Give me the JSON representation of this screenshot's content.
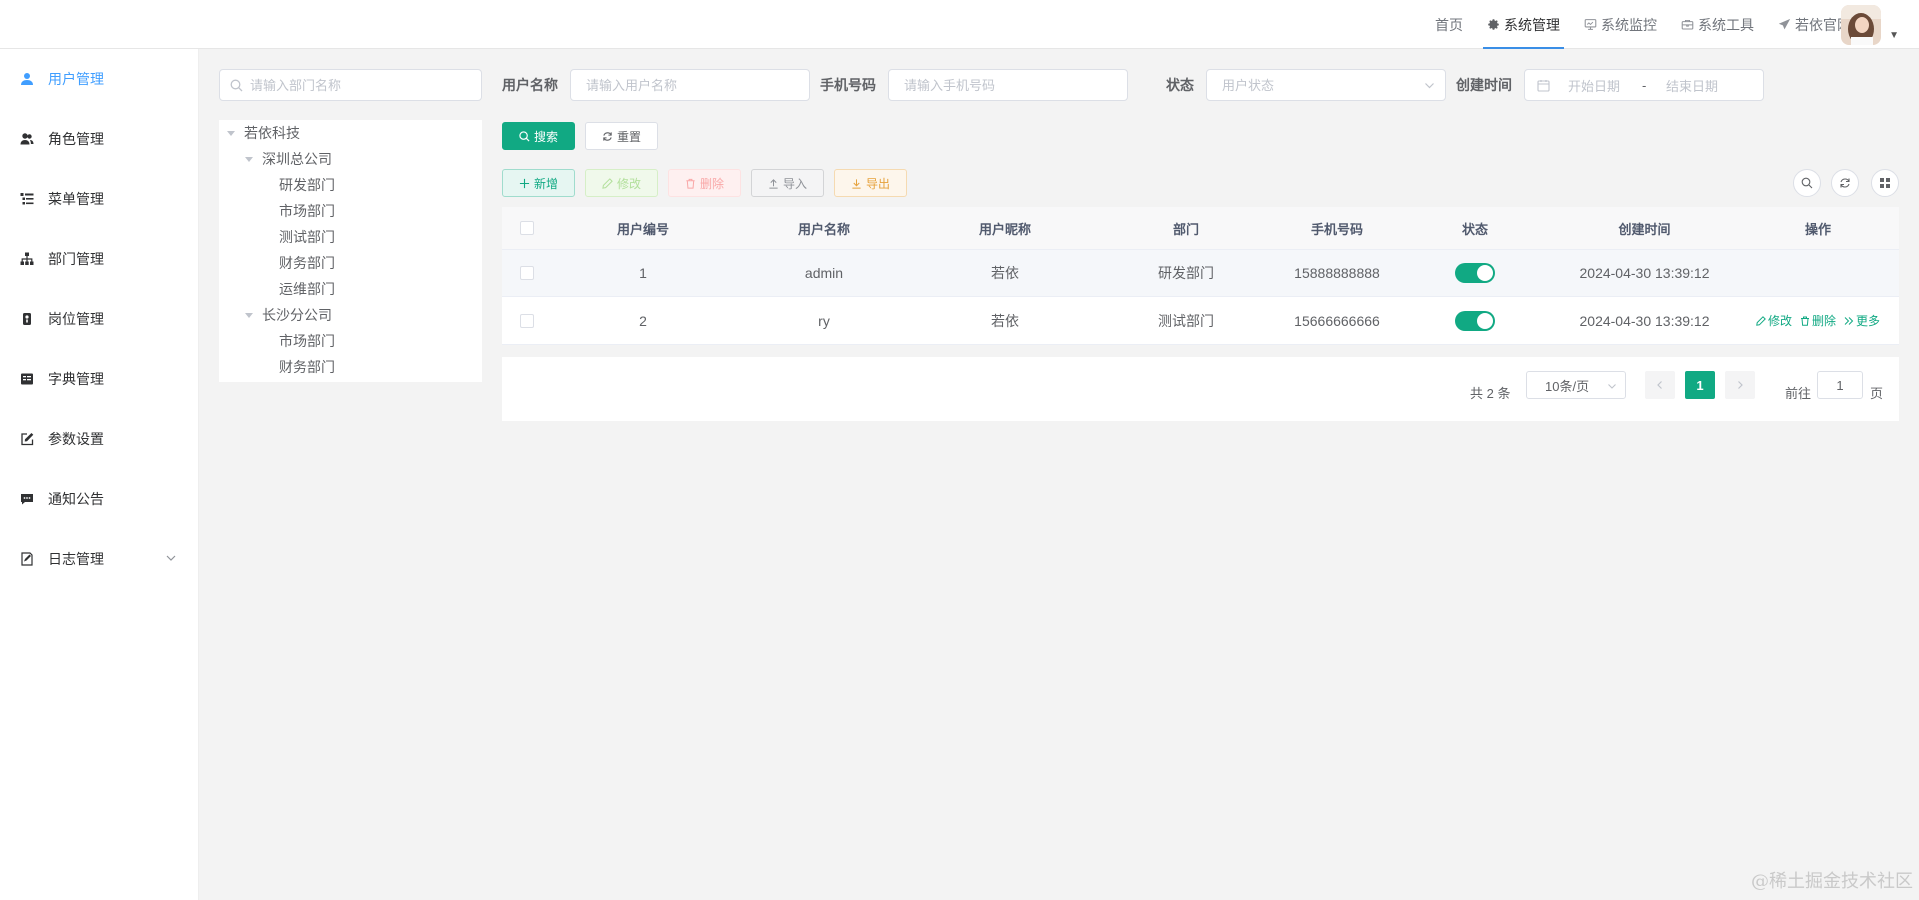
{
  "topnav": [
    {
      "label": "首页",
      "icon": "none"
    },
    {
      "label": "系统管理",
      "icon": "gear-icon",
      "active": true
    },
    {
      "label": "系统监控",
      "icon": "monitor-icon"
    },
    {
      "label": "系统工具",
      "icon": "toolbox-icon"
    },
    {
      "label": "若依官网",
      "icon": "send-icon"
    }
  ],
  "sidebar": {
    "items": [
      {
        "label": "用户管理",
        "icon": "user-icon",
        "active": true
      },
      {
        "label": "角色管理",
        "icon": "peoples-icon"
      },
      {
        "label": "菜单管理",
        "icon": "tree-table-icon"
      },
      {
        "label": "部门管理",
        "icon": "tree-icon"
      },
      {
        "label": "岗位管理",
        "icon": "post-icon"
      },
      {
        "label": "字典管理",
        "icon": "dict-icon"
      },
      {
        "label": "参数设置",
        "icon": "edit-icon"
      },
      {
        "label": "通知公告",
        "icon": "message-icon"
      },
      {
        "label": "日志管理",
        "icon": "log-icon",
        "expandable": true
      }
    ]
  },
  "dept": {
    "search_placeholder": "请输入部门名称",
    "tree": [
      {
        "label": "若依科技",
        "level": 0,
        "expanded": true
      },
      {
        "label": "深圳总公司",
        "level": 1,
        "expanded": true
      },
      {
        "label": "研发部门",
        "level": 2
      },
      {
        "label": "市场部门",
        "level": 2
      },
      {
        "label": "测试部门",
        "level": 2
      },
      {
        "label": "财务部门",
        "level": 2
      },
      {
        "label": "运维部门",
        "level": 2
      },
      {
        "label": "长沙分公司",
        "level": 1,
        "expanded": true
      },
      {
        "label": "市场部门",
        "level": 2
      },
      {
        "label": "财务部门",
        "level": 2
      }
    ]
  },
  "form": {
    "username_label": "用户名称",
    "username_placeholder": "请输入用户名称",
    "phone_label": "手机号码",
    "phone_placeholder": "请输入手机号码",
    "status_label": "状态",
    "status_placeholder": "用户状态",
    "date_label": "创建时间",
    "date_start": "开始日期",
    "date_sep": "-",
    "date_end": "结束日期",
    "search_btn": "搜索",
    "reset_btn": "重置"
  },
  "toolbar": {
    "add": "新增",
    "edit": "修改",
    "delete": "删除",
    "import": "导入",
    "export": "导出"
  },
  "table": {
    "headers": [
      "用户编号",
      "用户名称",
      "用户昵称",
      "部门",
      "手机号码",
      "状态",
      "创建时间",
      "操作"
    ],
    "rows": [
      {
        "id": "1",
        "username": "admin",
        "nickname": "若依",
        "dept": "研发部门",
        "phone": "15888888888",
        "status": true,
        "created": "2024-04-30 13:39:12",
        "ops": []
      },
      {
        "id": "2",
        "username": "ry",
        "nickname": "若依",
        "dept": "测试部门",
        "phone": "15666666666",
        "status": true,
        "created": "2024-04-30 13:39:12",
        "ops": [
          "修改",
          "删除",
          "更多"
        ]
      }
    ]
  },
  "pagination": {
    "total": "共 2 条",
    "page_size": "10条/页",
    "current": "1",
    "goto_label": "前往",
    "goto_value": "1",
    "unit": "页"
  },
  "watermark": "@稀土掘金技术社区",
  "colors": {
    "primary": "#11a983",
    "active_menu": "#409eff"
  }
}
